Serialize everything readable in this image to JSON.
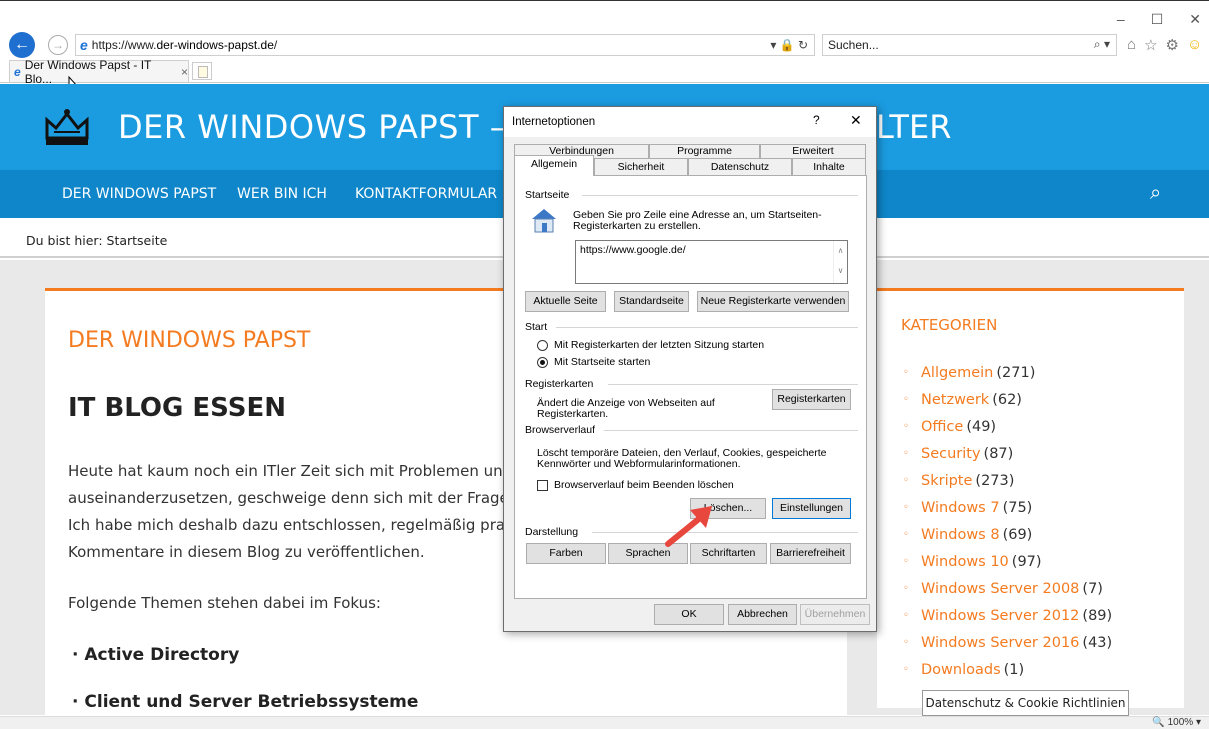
{
  "browser": {
    "url_prefix": "https://www.",
    "url_domain": "der-windows-papst.de",
    "url_suffix": "/",
    "url_tools": "▾ 🔒 ↻",
    "search_placeholder": "Suchen...",
    "search_icon": "⌕ ▾",
    "tab_title": "Der Windows Papst - IT Blo...",
    "tab_close": "×",
    "window_controls": [
      "–",
      "☐",
      "✕"
    ],
    "zoom": "🔍 100%  ▾"
  },
  "site": {
    "title_left": "DER WINDOWS PAPST –",
    "title_right": "LTER",
    "nav": [
      "DER WINDOWS PAPST",
      "WER BIN ICH",
      "KONTAKTFORMULAR"
    ],
    "breadcrumb": "Du bist hier:  Startseite",
    "heading_orange": "DER WINDOWS PAPST",
    "heading_blog": "IT BLOG ESSEN",
    "paragraphs": [
      "Heute hat kaum noch ein ITler Zeit sich mit Problemen und d",
      "auseinanderzusetzen, geschweige denn sich mit der Frage zu",
      "Ich habe mich deshalb dazu entschlossen, regelmäßig praktis",
      "Kommentare in diesem Blog zu veröffentlichen.",
      "Folgende Themen stehen dabei im Fokus:"
    ],
    "bullets": [
      "Active Directory",
      "Client und Server Betriebssysteme"
    ],
    "categories_title": "KATEGORIEN",
    "categories": [
      {
        "name": "Allgemein",
        "count": "(271)"
      },
      {
        "name": "Netzwerk",
        "count": "(62)"
      },
      {
        "name": "Office",
        "count": "(49)"
      },
      {
        "name": "Security",
        "count": "(87)"
      },
      {
        "name": "Skripte",
        "count": "(273)"
      },
      {
        "name": "Windows 7",
        "count": "(75)"
      },
      {
        "name": "Windows 8",
        "count": "(69)"
      },
      {
        "name": "Windows 10",
        "count": "(97)"
      },
      {
        "name": "Windows Server 2008",
        "count": "(7)"
      },
      {
        "name": "Windows Server 2012",
        "count": "(89)"
      },
      {
        "name": "Windows Server 2016",
        "count": "(43)"
      },
      {
        "name": "Downloads",
        "count": "(1)"
      }
    ],
    "cookie_button": "Datenschutz & Cookie Richtlinien"
  },
  "dialog": {
    "title": "Internetoptionen",
    "help": "?",
    "close": "✕",
    "tabs_back": [
      "Verbindungen",
      "Programme",
      "Erweitert"
    ],
    "tabs_front": [
      "Allgemein",
      "Sicherheit",
      "Datenschutz",
      "Inhalte"
    ],
    "startseite": {
      "label": "Startseite",
      "desc": "Geben Sie pro Zeile eine Adresse an, um Startseiten-Registerkarten zu erstellen.",
      "url": "https://www.google.de/",
      "btn_current": "Aktuelle Seite",
      "btn_default": "Standardseite",
      "btn_newtab": "Neue Registerkarte verwenden"
    },
    "start": {
      "label": "Start",
      "opt1": "Mit Registerkarten der letzten Sitzung starten",
      "opt2": "Mit Startseite starten"
    },
    "registerkarten": {
      "label": "Registerkarten",
      "desc": "Ändert die Anzeige von Webseiten auf Registerkarten.",
      "btn": "Registerkarten"
    },
    "verlauf": {
      "label": "Browserverlauf",
      "desc": "Löscht temporäre Dateien, den Verlauf, Cookies, gespeicherte Kennwörter und Webformularinformationen.",
      "checkbox": "Browserverlauf beim Beenden löschen",
      "btn_delete": "Löschen...",
      "btn_settings": "Einstellungen"
    },
    "darstellung": {
      "label": "Darstellung",
      "btns": [
        "Farben",
        "Sprachen",
        "Schriftarten",
        "Barrierefreiheit"
      ]
    },
    "footer": {
      "ok": "OK",
      "cancel": "Abbrechen",
      "apply": "Übernehmen"
    }
  }
}
